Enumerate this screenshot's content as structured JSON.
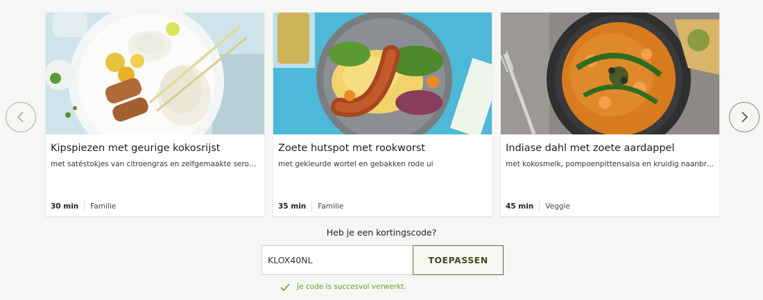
{
  "carousel": {
    "prev_icon": "chevron-left-icon",
    "next_icon": "chevron-right-icon",
    "recipes": [
      {
        "title": "Kipspiezen met geurige kokosrijst",
        "subtitle": "met satéstokjes van citroengras en zelfgemaakte seroendeng",
        "time": "30 min",
        "tag": "Familie"
      },
      {
        "title": "Zoete hutspot met rookworst",
        "subtitle": "met gekleurde wortel en gebakken rode ui",
        "time": "35 min",
        "tag": "Familie"
      },
      {
        "title": "Indiase dahl met zoete aardappel",
        "subtitle": "met kokosmelk, pompoenpittensalsa en kruidig naanbrood",
        "time": "45 min",
        "tag": "Veggie"
      }
    ]
  },
  "promo": {
    "label": "Heb je een kortingscode?",
    "code_value": "KLOX40NL",
    "apply_label": "TOEPASSEN",
    "success_message": "Je code is succesvol verwerkt.",
    "success_icon": "checkmark-icon"
  },
  "colors": {
    "accent_green": "#6aa02d",
    "button_border": "#5d6a3a",
    "background": "#f6f6f4"
  }
}
